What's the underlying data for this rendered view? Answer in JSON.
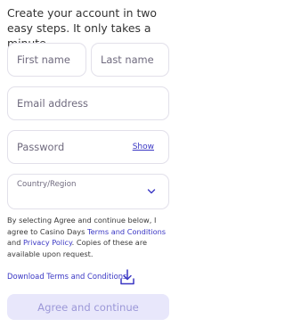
{
  "intro": "Create your account in two easy steps. It only takes a minute.",
  "form": {
    "first_name_placeholder": "First name",
    "last_name_placeholder": "Last name",
    "email_placeholder": "Email address",
    "password_placeholder": "Password",
    "show_label": "Show",
    "country_label": "Country/Region"
  },
  "consent": {
    "text_1": "By selecting Agree and continue below, I agree to Casino Days ",
    "terms_link": "Terms and Conditions",
    "text_2": " and ",
    "privacy_link": "Privacy Policy",
    "text_3": ". Copies of these are available upon request."
  },
  "download": {
    "label": "Download Terms and Conditions",
    "icon": "download-icon"
  },
  "agree_button": "Agree and continue",
  "colors": {
    "accent": "#3a37c4",
    "button_bg": "#e8e7fb",
    "button_text": "#9c98d8",
    "border": "#e2e0ea"
  }
}
